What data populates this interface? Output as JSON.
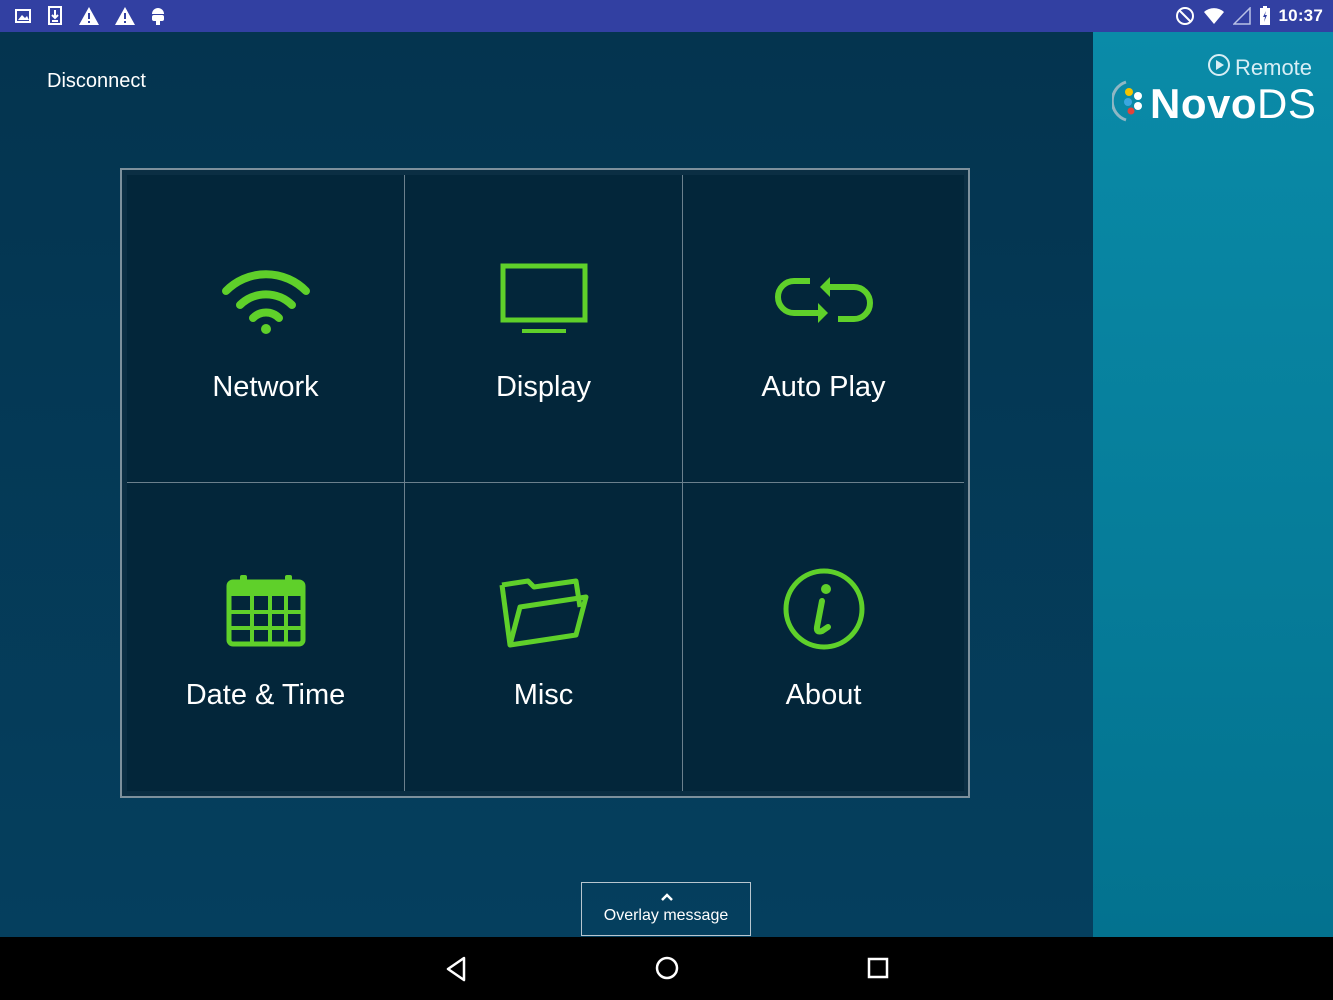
{
  "status_bar": {
    "time": "10:37",
    "left_icons": [
      "image-icon",
      "download-icon",
      "warning-icon",
      "warning-icon",
      "android-icon"
    ],
    "right_icons": [
      "do-not-disturb-icon",
      "wifi-icon",
      "cell-signal-icon",
      "battery-icon"
    ]
  },
  "header": {
    "disconnect_label": "Disconnect"
  },
  "logo": {
    "remote_label": "Remote",
    "brand_novo": "Novo",
    "brand_ds": "DS"
  },
  "tiles": [
    {
      "label": "Network",
      "icon": "wifi-icon"
    },
    {
      "label": "Display",
      "icon": "monitor-icon"
    },
    {
      "label": "Auto Play",
      "icon": "repeat-icon"
    },
    {
      "label": "Date & Time",
      "icon": "calendar-icon"
    },
    {
      "label": "Misc",
      "icon": "folder-icon"
    },
    {
      "label": "About",
      "icon": "info-icon"
    }
  ],
  "overlay": {
    "label": "Overlay message"
  },
  "colors": {
    "accent_green": "#5fd02a",
    "status_bar": "#3240a2",
    "main_bg": "#04344f",
    "side_panel": "#0a8ba8"
  }
}
